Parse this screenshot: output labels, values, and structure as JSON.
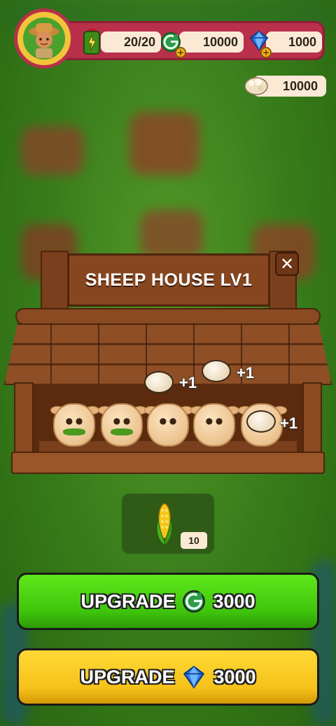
{
  "hud": {
    "avatar_icon": "farmer-avatar-icon",
    "energy": {
      "icon": "energy-battery-icon",
      "value": "20/20"
    },
    "coins": {
      "icon": "g-coin-icon",
      "value": "10000",
      "add_icon": "plus-icon"
    },
    "gems": {
      "icon": "blue-gem-icon",
      "value": "1000",
      "add_icon": "plus-icon"
    },
    "wool": {
      "icon": "wool-icon",
      "value": "10000"
    }
  },
  "building": {
    "title": "SHEEP HOUSE LV1",
    "close_label": "✕",
    "sheep_count": 5,
    "production": [
      {
        "label": "+1"
      },
      {
        "label": "+1"
      },
      {
        "label": "+1"
      }
    ]
  },
  "feed": {
    "icon": "corn-icon",
    "count": "10"
  },
  "buttons": {
    "upgrade_coins": {
      "label": "UPGRADE",
      "cost": "3000",
      "icon": "g-coin-icon"
    },
    "upgrade_gems": {
      "label": "UPGRADE",
      "cost": "3000",
      "icon": "blue-gem-icon"
    }
  },
  "colors": {
    "hud_bar": "#b8304a",
    "green_button": "#3ec40c",
    "yellow_button": "#f6c21a",
    "wood": "#86461f"
  }
}
